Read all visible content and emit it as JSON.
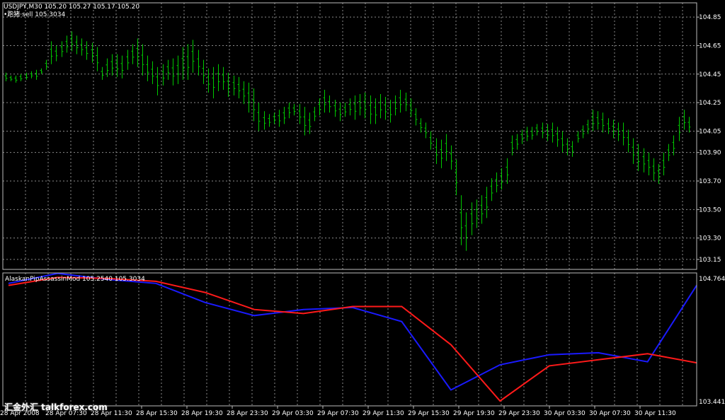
{
  "header": {
    "symbol_line": "USDJPY,M30  105.20 105.27 105.17 105.20",
    "signal_line": "•跑猪·sell 105.3034"
  },
  "indicator": {
    "title": "AlaskanPipAssassinMod 105.2540 105.3034"
  },
  "watermark": "汇金外汇 talkforex.com",
  "colors": {
    "background": "#000000",
    "grid": "#8a8a8a",
    "price_bars": "#00c800",
    "blue_line": "#1a1aff",
    "red_line": "#ff1a1a",
    "text": "#ffffff"
  },
  "chart_data": [
    {
      "type": "ohlc",
      "title": "USDJPY,M30",
      "ylim": [
        103.08,
        104.95
      ],
      "yticks": [
        "104.85",
        "104.65",
        "104.45",
        "104.25",
        "104.05",
        "103.90",
        "103.70",
        "103.50",
        "103.30",
        "103.15"
      ],
      "highs": [
        104.46,
        104.44,
        104.44,
        104.45,
        104.46,
        104.47,
        104.48,
        104.49,
        104.55,
        104.68,
        104.65,
        104.68,
        104.72,
        104.75,
        104.72,
        104.7,
        104.68,
        104.67,
        104.64,
        104.5,
        104.56,
        104.59,
        104.59,
        104.58,
        104.62,
        104.66,
        104.7,
        104.66,
        104.58,
        104.54,
        104.5,
        104.52,
        104.55,
        104.56,
        104.58,
        104.64,
        104.66,
        104.69,
        104.62,
        104.55,
        104.49,
        104.5,
        104.52,
        104.5,
        104.46,
        104.44,
        104.43,
        104.4,
        104.39,
        104.35,
        104.25,
        104.19,
        104.17,
        104.18,
        104.2,
        104.22,
        104.25,
        104.24,
        104.24,
        104.22,
        104.18,
        104.22,
        104.28,
        104.34,
        104.3,
        104.27,
        104.25,
        104.25,
        104.28,
        104.3,
        104.31,
        104.32,
        104.3,
        104.28,
        104.31,
        104.29,
        104.27,
        104.3,
        104.34,
        104.32,
        104.28,
        104.21,
        104.14,
        104.11,
        104.05,
        104.0,
        103.99,
        104.03,
        103.95,
        103.85,
        103.6,
        103.48,
        103.55,
        103.57,
        103.6,
        103.66,
        103.72,
        103.76,
        103.79,
        103.86,
        104.02,
        104.03,
        104.06,
        104.08,
        104.08,
        104.1,
        104.11,
        104.1,
        104.11,
        104.08,
        104.05,
        104.0,
        103.98,
        104.05,
        104.09,
        104.13,
        104.2,
        104.19,
        104.18,
        104.14,
        104.13,
        104.11,
        104.11,
        104.06,
        104.0,
        103.96,
        103.93,
        103.9,
        103.86,
        103.82,
        103.9,
        103.96,
        104.02,
        104.15,
        104.2,
        104.15
      ],
      "lows": [
        104.4,
        104.4,
        104.39,
        104.4,
        104.41,
        104.42,
        104.41,
        104.45,
        104.48,
        104.52,
        104.54,
        104.57,
        104.6,
        104.61,
        104.59,
        104.58,
        104.55,
        104.53,
        104.47,
        104.41,
        104.43,
        104.44,
        104.43,
        104.42,
        104.48,
        104.52,
        104.5,
        104.44,
        104.4,
        104.38,
        104.3,
        104.37,
        104.41,
        104.37,
        104.38,
        104.41,
        104.41,
        104.46,
        104.44,
        104.38,
        104.32,
        104.28,
        104.33,
        104.34,
        104.29,
        104.3,
        104.28,
        104.24,
        104.18,
        104.12,
        104.05,
        104.06,
        104.08,
        104.1,
        104.08,
        104.1,
        104.14,
        104.16,
        104.1,
        104.02,
        104.03,
        104.12,
        104.16,
        104.18,
        104.18,
        104.15,
        104.12,
        104.15,
        104.16,
        104.13,
        104.16,
        104.14,
        104.1,
        104.1,
        104.14,
        104.13,
        104.11,
        104.16,
        104.18,
        104.19,
        104.15,
        104.09,
        104.04,
        104.0,
        103.92,
        103.82,
        103.79,
        103.84,
        103.78,
        103.6,
        103.25,
        103.21,
        103.32,
        103.37,
        103.4,
        103.44,
        103.56,
        103.62,
        103.64,
        103.68,
        103.88,
        103.92,
        103.96,
        103.98,
        103.99,
        104.02,
        104.0,
        103.98,
        103.97,
        103.94,
        103.9,
        103.88,
        103.87,
        103.97,
        104.0,
        104.03,
        104.05,
        104.06,
        104.04,
        104.03,
        104.0,
        103.98,
        103.95,
        103.9,
        103.82,
        103.77,
        103.76,
        103.74,
        103.7,
        103.68,
        103.74,
        103.84,
        103.88,
        103.98,
        104.06,
        104.04
      ]
    },
    {
      "type": "line",
      "title": "AlaskanPipAssassinMod",
      "ylim": [
        103.4415,
        104.764
      ],
      "ytick_labels": [
        "104.764",
        "103.4415"
      ],
      "x": [
        "28 Apr 2008",
        "28 Apr 07:30",
        "28 Apr 11:30",
        "28 Apr 15:30",
        "28 Apr 19:30",
        "28 Apr 23:30",
        "29 Apr 03:30",
        "29 Apr 07:30",
        "29 Apr 11:30",
        "29 Apr 15:30",
        "29 Apr 19:30",
        "29 Apr 23:30",
        "30 Apr 03:30",
        "30 Apr 07:30",
        "30 Apr 11:30"
      ],
      "series": [
        {
          "name": "blue",
          "values": [
            104.66,
            104.76,
            104.7,
            104.66,
            104.47,
            104.34,
            104.4,
            104.42,
            104.28,
            103.6,
            103.85,
            103.95,
            103.97,
            103.88,
            104.64
          ]
        },
        {
          "name": "red",
          "values": [
            104.64,
            104.72,
            104.71,
            104.68,
            104.57,
            104.4,
            104.36,
            104.43,
            104.43,
            104.05,
            103.49,
            103.84,
            103.9,
            103.96,
            103.87
          ]
        }
      ]
    }
  ]
}
